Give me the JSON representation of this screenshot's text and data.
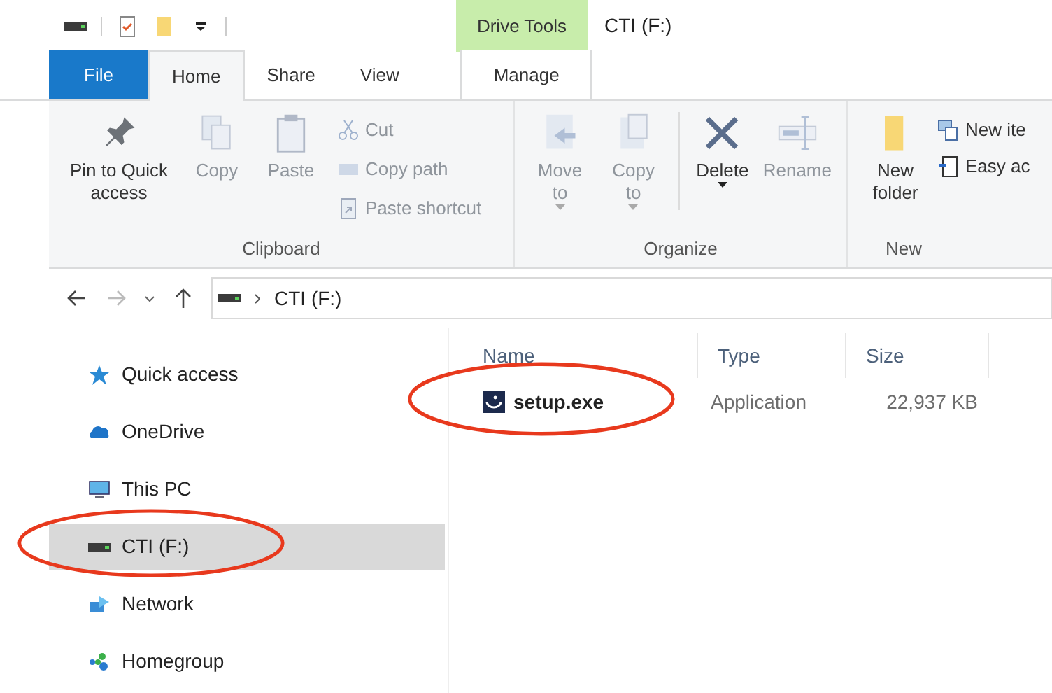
{
  "window": {
    "title": "CTI (F:)",
    "context_tab_group": "Drive Tools"
  },
  "tabs": [
    {
      "label": "File",
      "kind": "file",
      "selected": false
    },
    {
      "label": "Home",
      "kind": "tab",
      "selected": true
    },
    {
      "label": "Share",
      "kind": "tab",
      "selected": false
    },
    {
      "label": "View",
      "kind": "tab",
      "selected": false
    },
    {
      "label": "Manage",
      "kind": "context",
      "selected": false
    }
  ],
  "ribbon": {
    "clipboard": {
      "label": "Clipboard",
      "pin": {
        "label": "Pin to Quick access",
        "disabled": false
      },
      "copy": {
        "label": "Copy",
        "disabled": true
      },
      "paste": {
        "label": "Paste",
        "disabled": true
      },
      "cut": {
        "label": "Cut",
        "disabled": true
      },
      "copy_path": {
        "label": "Copy path",
        "disabled": true
      },
      "paste_shortcut": {
        "label": "Paste shortcut",
        "disabled": true
      }
    },
    "organize": {
      "label": "Organize",
      "move_to": {
        "label": "Move\nto",
        "disabled": true
      },
      "copy_to": {
        "label": "Copy\nto",
        "disabled": true
      },
      "delete": {
        "label": "Delete",
        "disabled": false
      },
      "rename": {
        "label": "Rename",
        "disabled": true
      }
    },
    "new": {
      "label": "New",
      "new_folder": {
        "label": "New\nfolder",
        "disabled": false
      },
      "new_item": {
        "label": "New ite",
        "disabled": false
      },
      "easy_access": {
        "label": "Easy ac",
        "disabled": false
      }
    }
  },
  "address_bar": {
    "path": "CTI (F:)"
  },
  "sidebar": {
    "items": [
      {
        "label": "Quick access",
        "kind": "quick",
        "selected": false,
        "circled": false
      },
      {
        "label": "OneDrive",
        "kind": "cloud",
        "selected": false,
        "circled": false
      },
      {
        "label": "This PC",
        "kind": "pc",
        "selected": false,
        "circled": false
      },
      {
        "label": "CTI (F:)",
        "kind": "drive",
        "selected": true,
        "circled": true
      },
      {
        "label": "Network",
        "kind": "network",
        "selected": false,
        "circled": false
      },
      {
        "label": "Homegroup",
        "kind": "homegroup",
        "selected": false,
        "circled": false
      }
    ]
  },
  "file_list": {
    "columns": [
      "Name",
      "Type",
      "Size"
    ],
    "rows": [
      {
        "name": "setup.exe",
        "type": "Application",
        "size": "22,937 KB",
        "circled": true
      }
    ]
  }
}
